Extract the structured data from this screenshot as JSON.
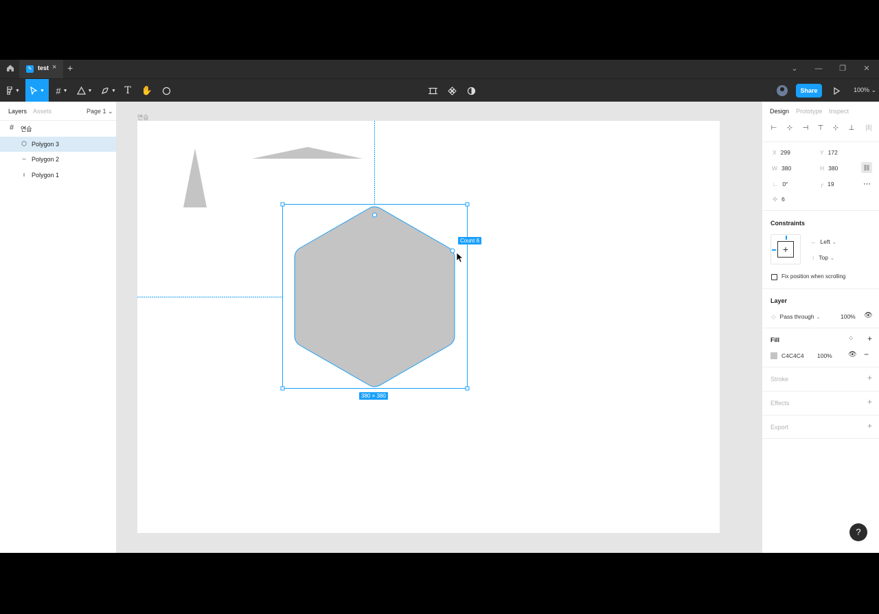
{
  "titlebar": {
    "home_icon": "home-icon",
    "tab_label": "test",
    "tab_close": "×",
    "tab_add": "+"
  },
  "toolbar": {
    "share_label": "Share",
    "zoom_label": "100%"
  },
  "left_panel": {
    "tab_layers": "Layers",
    "tab_assets": "Assets",
    "page_select": "Page 1",
    "frame_layer": "연습",
    "layers": [
      {
        "label": "Polygon 3",
        "icon": "polygon-icon"
      },
      {
        "label": "Polygon 2",
        "icon": "polygon-icon"
      },
      {
        "label": "Polygon 1",
        "icon": "polygon-icon"
      }
    ]
  },
  "canvas": {
    "frame_label": "연습",
    "count_badge": "Count 6",
    "size_badge": "380 × 380",
    "fill_color": "#C4C4C4",
    "selection_color": "#18A0FB"
  },
  "right_panel": {
    "tab_design": "Design",
    "tab_prototype": "Prototype",
    "tab_inspect": "Inspect",
    "x_label": "X",
    "x_value": "299",
    "y_label": "Y",
    "y_value": "172",
    "w_label": "W",
    "w_value": "380",
    "h_label": "H",
    "h_value": "380",
    "rotation_value": "0°",
    "radius_value": "19",
    "count_value": "6",
    "constraints_title": "Constraints",
    "constraint_h": "Left",
    "constraint_v": "Top",
    "fix_position_label": "Fix position when scrolling",
    "layer_title": "Layer",
    "blend_mode": "Pass through",
    "layer_opacity": "100%",
    "fill_title": "Fill",
    "fill_hex": "C4C4C4",
    "fill_opacity": "100%",
    "stroke_title": "Stroke",
    "effects_title": "Effects",
    "export_title": "Export"
  },
  "help_label": "?"
}
